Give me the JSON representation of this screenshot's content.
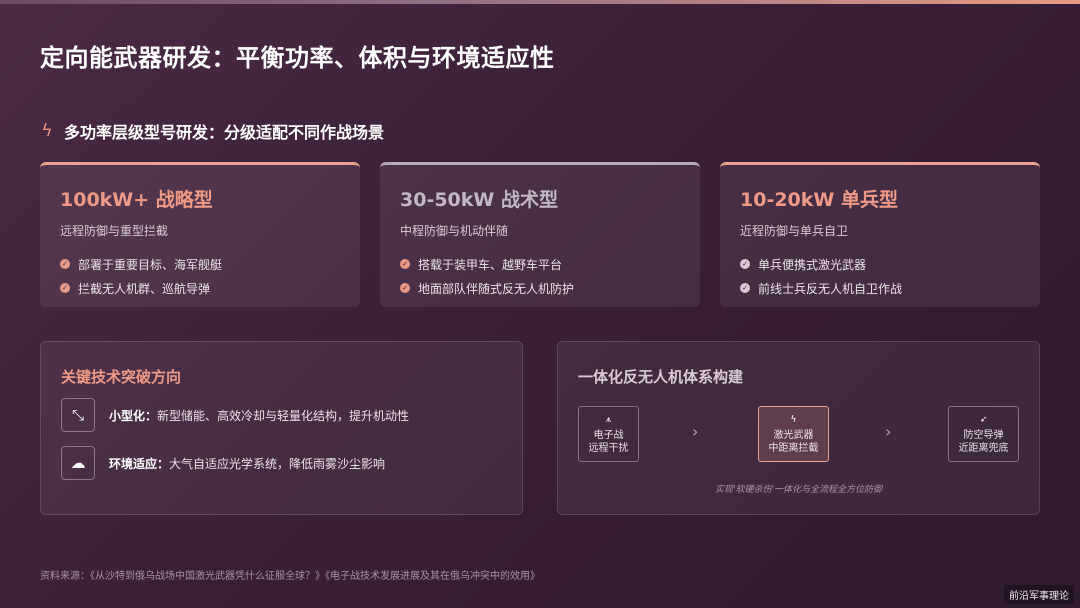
{
  "page_title": "定向能武器研发：平衡功率、体积与环境适应性",
  "section": {
    "icon": "bolt-icon",
    "heading": "多功率层级型号研发：分级适配不同作战场景"
  },
  "tiers": [
    {
      "title": "100kW+ 战略型",
      "subtitle": "远程防御与重型拦截",
      "bullets": [
        "部署于重要目标、海军舰艇",
        "拦截无人机群、巡航导弹"
      ]
    },
    {
      "title": "30-50kW 战术型",
      "subtitle": "中程防御与机动伴随",
      "bullets": [
        "搭载于装甲车、越野车平台",
        "地面部队伴随式反无人机防护"
      ]
    },
    {
      "title": "10-20kW 单兵型",
      "subtitle": "近程防御与单兵自卫",
      "bullets": [
        "单兵便携式激光武器",
        "前线士兵反无人机自卫作战"
      ]
    }
  ],
  "breakthrough": {
    "title": "关键技术突破方向",
    "items": [
      {
        "icon": "compress-icon",
        "label": "小型化：",
        "text": "新型储能、高效冷却与轻量化结构，提升机动性"
      },
      {
        "icon": "cloud-sun-icon",
        "label": "环境适应：",
        "text": "大气自适应光学系统，降低雨雾沙尘影响"
      }
    ]
  },
  "system": {
    "title": "一体化反无人机体系构建",
    "nodes": [
      {
        "icon": "antenna-icon",
        "line1": "电子战",
        "line2": "远程干扰"
      },
      {
        "icon": "bolt-icon",
        "line1": "激光武器",
        "line2": "中距离拦截"
      },
      {
        "icon": "rocket-icon",
        "line1": "防空导弹",
        "line2": "近距离兜底"
      }
    ],
    "caption": "实现'软硬杀伤'一体化与全流程全方位防御"
  },
  "source": "资料来源：《从沙特到俄乌战场中国激光武器凭什么征服全球？》《电子战技术发展进展及其在俄乌冲突中的效用》",
  "watermark": "前沿军事理论",
  "colors": {
    "accent": "#f09a86",
    "background": "#3a1f38",
    "muted_accent": "#c3b7c6"
  }
}
